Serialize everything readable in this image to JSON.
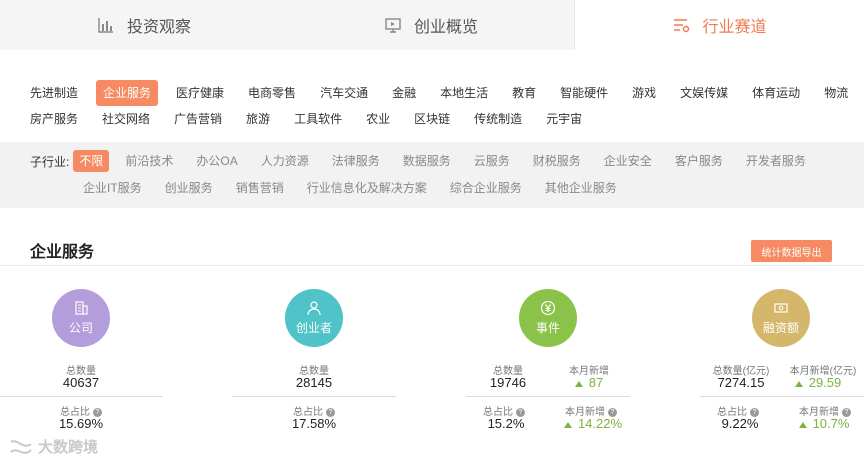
{
  "top_tabs": [
    {
      "label": "投资观察",
      "icon": "bar-chart-icon"
    },
    {
      "label": "创业概览",
      "icon": "presentation-icon"
    },
    {
      "label": "行业赛道",
      "icon": "filter-list-icon"
    }
  ],
  "industries": {
    "row1": [
      "先进制造",
      "企业服务",
      "医疗健康",
      "电商零售",
      "汽车交通",
      "金融",
      "本地生活",
      "教育",
      "智能硬件",
      "游戏",
      "文娱传媒",
      "体育运动",
      "物流"
    ],
    "row2": [
      "房产服务",
      "社交网络",
      "广告营销",
      "旅游",
      "工具软件",
      "农业",
      "区块链",
      "传统制造",
      "元宇宙"
    ],
    "active": "企业服务"
  },
  "sub_industries": {
    "label": "子行业:",
    "row1": [
      "不限",
      "前沿技术",
      "办公OA",
      "人力资源",
      "法律服务",
      "数据服务",
      "云服务",
      "财税服务",
      "企业安全",
      "客户服务",
      "开发者服务"
    ],
    "row2": [
      "企业IT服务",
      "创业服务",
      "销售营销",
      "行业信息化及解决方案",
      "综合企业服务",
      "其他企业服务"
    ],
    "active": "不限"
  },
  "section": {
    "title": "企业服务",
    "export_label": "统计数据导出"
  },
  "stats": {
    "company": {
      "name": "公司",
      "total_label": "总数量",
      "total": "40637",
      "ratio_label": "总占比",
      "ratio": "15.69%",
      "color": "#b39ddb"
    },
    "founder": {
      "name": "创业者",
      "total_label": "总数量",
      "total": "28145",
      "ratio_label": "总占比",
      "ratio": "17.58%",
      "color": "#4fc3c7"
    },
    "event": {
      "name": "事件",
      "total_label": "总数量",
      "total": "19746",
      "month_label": "本月新增",
      "month": "87",
      "ratio_label": "总占比",
      "ratio": "15.2%",
      "month_ratio_label": "本月新增",
      "month_ratio": "14.22%",
      "color": "#8bc34a"
    },
    "funding": {
      "name": "融资额",
      "total_label": "总数量(亿元)",
      "total": "7274.15",
      "month_label": "本月新增(亿元)",
      "month": "29.59",
      "ratio_label": "总占比",
      "ratio": "9.22%",
      "month_ratio_label": "本月新增",
      "month_ratio": "10.7%",
      "color": "#d4b76a"
    }
  },
  "watermark": "大数跨境"
}
